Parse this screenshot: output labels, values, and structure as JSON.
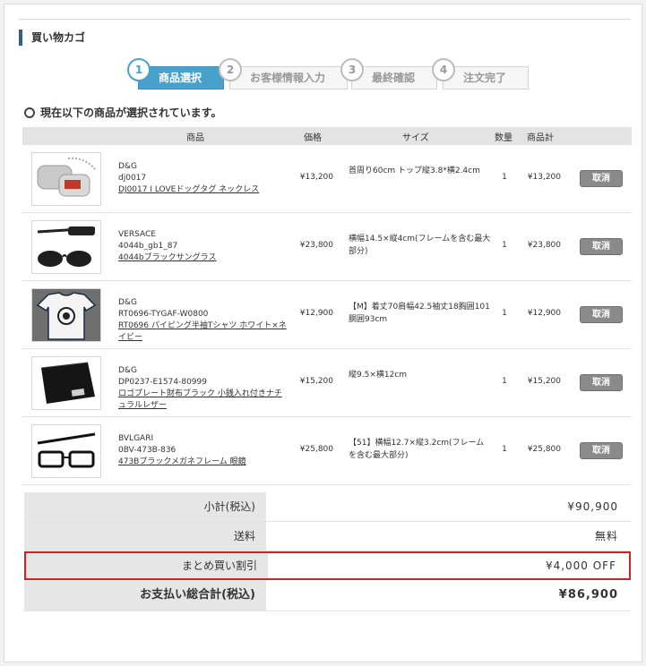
{
  "page": {
    "title": "買い物カゴ"
  },
  "steps": [
    {
      "num": "1",
      "label": "商品選択"
    },
    {
      "num": "2",
      "label": "お客様情報入力"
    },
    {
      "num": "3",
      "label": "最終確認"
    },
    {
      "num": "4",
      "label": "注文完了"
    }
  ],
  "selected_heading": "現在以下の商品が選択されています。",
  "columns": {
    "product": "商品",
    "price": "価格",
    "size": "サイズ",
    "qty": "数量",
    "subtotal": "商品計"
  },
  "items": [
    {
      "brand": "D&G",
      "code": "dj0017",
      "name": "DJ0017 I LOVEドッグタグ ネックレス",
      "price": "¥13,200",
      "size": "首周り60cm トップ縦3.8*横2.4cm",
      "qty": "1",
      "subtotal": "¥13,200",
      "cancel": "取消",
      "image": "dog-tag-necklace-image"
    },
    {
      "brand": "VERSACE",
      "code": "4044b_gb1_87",
      "name": "4044bブラックサングラス",
      "price": "¥23,800",
      "size": "横幅14.5×縦4cm(フレームを含む最大部分)",
      "qty": "1",
      "subtotal": "¥23,800",
      "cancel": "取消",
      "image": "sunglasses-image"
    },
    {
      "brand": "D&G",
      "code": "RT0696-TYGAF-W0800",
      "name": "RT0696 パイピング半袖Tシャツ ホワイト×ネイビー",
      "price": "¥12,900",
      "size": "【M】着丈70肩幅42.5袖丈18胸囲101胴囲93cm",
      "qty": "1",
      "subtotal": "¥12,900",
      "cancel": "取消",
      "image": "tshirt-image"
    },
    {
      "brand": "D&G",
      "code": "DP0237-E1574-80999",
      "name": "ロゴプレート財布ブラック 小銭入れ付きナチュラルレザー",
      "price": "¥15,200",
      "size": "縦9.5×横12cm",
      "qty": "1",
      "subtotal": "¥15,200",
      "cancel": "取消",
      "image": "wallet-image"
    },
    {
      "brand": "BVLGARI",
      "code": "0BV-473B-836",
      "name": "473Bブラックメガネフレーム 眼鏡",
      "price": "¥25,800",
      "size": "【51】横幅12.7×縦3.2cm(フレームを含む最大部分)",
      "qty": "1",
      "subtotal": "¥25,800",
      "cancel": "取消",
      "image": "eyeglass-frame-image"
    }
  ],
  "totals": {
    "subtotal_label": "小計(税込)",
    "subtotal_value": "¥90,900",
    "shipping_label": "送料",
    "shipping_value": "無料",
    "discount_label": "まとめ買い割引",
    "discount_value": "¥4,000 OFF",
    "grand_label": "お支払い総合計(税込)",
    "grand_value": "¥86,900"
  },
  "colors": {
    "step_active": "#48a1cc",
    "title_bar": "#2f5e8f",
    "discount_border": "#d81f1f",
    "cancel_button": "#8a8a8a"
  }
}
